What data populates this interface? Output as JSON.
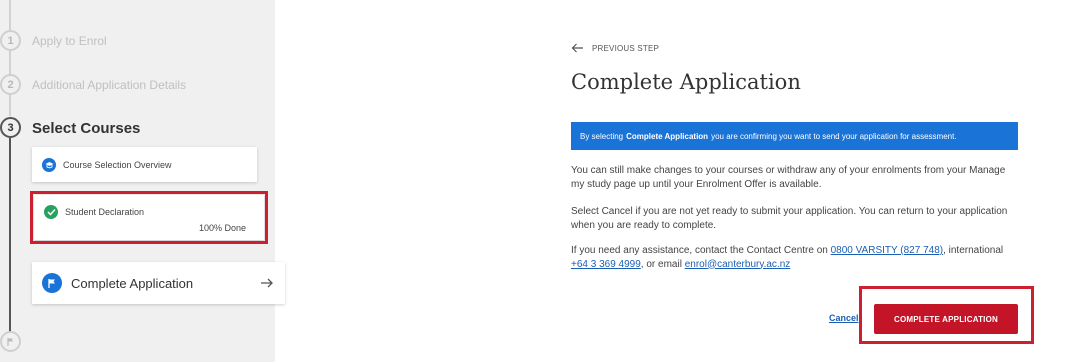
{
  "sidebar": {
    "steps": [
      {
        "number": "1",
        "label": "Apply to Enrol"
      },
      {
        "number": "2",
        "label": "Additional Application Details"
      },
      {
        "number": "3",
        "label": "Select Courses"
      }
    ],
    "cards": {
      "overview": {
        "label": "Course Selection Overview"
      },
      "declaration": {
        "label": "Student Declaration",
        "progress": "100% Done"
      },
      "complete": {
        "label": "Complete Application"
      }
    }
  },
  "main": {
    "previous_step": "PREVIOUS STEP",
    "title": "Complete Application",
    "banner": {
      "prefix": "By selecting",
      "bold": "Complete Application",
      "suffix": "you are confirming you want to send your application for assessment."
    },
    "paragraph1": "You can still make changes to your courses or withdraw any of your enrolments from your Manage my study page up until your Enrolment Offer is available.",
    "paragraph2": "Select Cancel if you are not yet ready to submit your application. You can return to your application when you are ready to complete.",
    "paragraph3": {
      "text1": "If you need any assistance, contact the Contact Centre on",
      "phone_link": "0800 VARSITY (827 748)",
      "text2": ", international",
      "intl_link": "+64 3 369 4999",
      "text3": ", or email",
      "email_link": "enrol@canterbury.ac.nz"
    },
    "cancel_label": "Cancel",
    "complete_button": "COMPLETE APPLICATION"
  },
  "colors": {
    "accent_blue": "#1a73d6",
    "cta_red": "#c41428",
    "highlight_red": "#cc1f2f",
    "success_green": "#27a060"
  }
}
